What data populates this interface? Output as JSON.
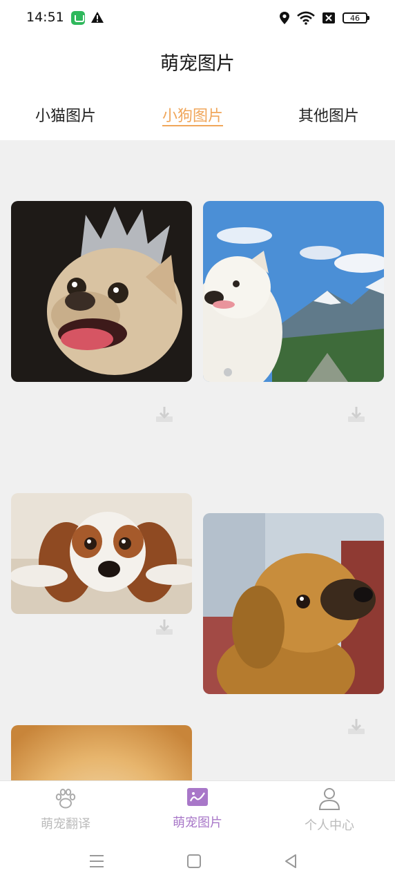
{
  "status_bar": {
    "time": "14:51",
    "battery": "46",
    "icons": [
      "app-notification-icon",
      "warning-icon",
      "location-icon",
      "wifi-icon",
      "no-sim-icon",
      "battery-icon"
    ]
  },
  "header": {
    "title": "萌宠图片"
  },
  "tabs": [
    {
      "label": "小猫图片",
      "active": false
    },
    {
      "label": "小狗图片",
      "active": true
    },
    {
      "label": "其他图片",
      "active": false
    }
  ],
  "gallery": {
    "items": [
      {
        "subject": "french-bulldog-with-crown",
        "download_icon": "download-icon"
      },
      {
        "subject": "samoyed-mountains",
        "download_icon": "download-icon"
      },
      {
        "subject": "cavalier-spaniel-on-rug",
        "download_icon": "download-icon"
      },
      {
        "subject": "tan-puppy-looking-up",
        "download_icon": "download-icon"
      },
      {
        "subject": "golden-fluffy-puppy"
      }
    ]
  },
  "bottom_nav": [
    {
      "label": "萌宠翻译",
      "icon": "paw-icon",
      "active": false
    },
    {
      "label": "萌宠图片",
      "icon": "picture-icon",
      "active": true
    },
    {
      "label": "个人中心",
      "icon": "person-icon",
      "active": false
    }
  ],
  "colors": {
    "tab_active": "#f0a65a",
    "nav_active": "#a877c8",
    "nav_inactive": "#bbbbbb",
    "content_bg": "#f0f0f0"
  }
}
